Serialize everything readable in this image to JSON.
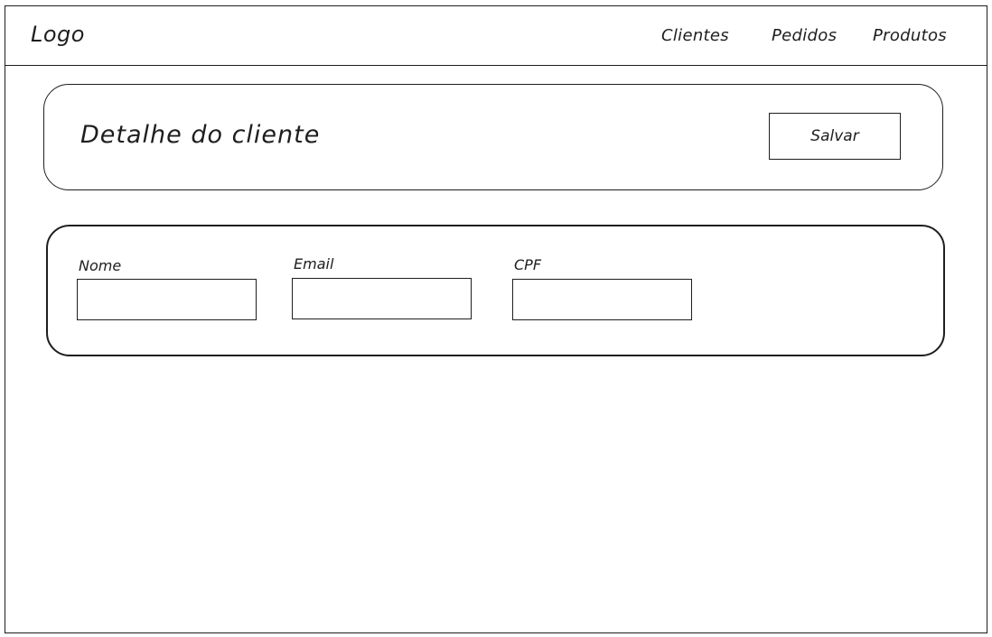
{
  "navbar": {
    "logo": "Logo",
    "items": [
      {
        "label": "Clientes"
      },
      {
        "label": "Pedidos"
      },
      {
        "label": "Produtos"
      }
    ]
  },
  "header": {
    "title": "Detalhe do cliente",
    "save_label": "Salvar"
  },
  "form": {
    "fields": [
      {
        "label": "Nome",
        "value": ""
      },
      {
        "label": "Email",
        "value": ""
      },
      {
        "label": "CPF",
        "value": ""
      }
    ]
  }
}
